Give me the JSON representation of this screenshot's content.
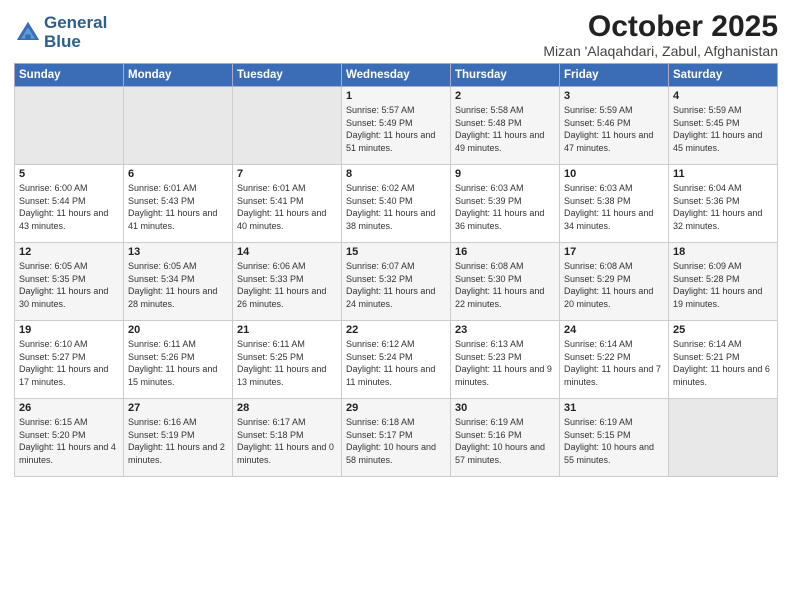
{
  "header": {
    "logo_line1": "General",
    "logo_line2": "Blue",
    "month": "October 2025",
    "location": "Mizan 'Alaqahdari, Zabul, Afghanistan"
  },
  "days_of_week": [
    "Sunday",
    "Monday",
    "Tuesday",
    "Wednesday",
    "Thursday",
    "Friday",
    "Saturday"
  ],
  "weeks": [
    [
      {
        "day": "",
        "sunrise": "",
        "sunset": "",
        "daylight": "",
        "empty": true
      },
      {
        "day": "",
        "sunrise": "",
        "sunset": "",
        "daylight": "",
        "empty": true
      },
      {
        "day": "",
        "sunrise": "",
        "sunset": "",
        "daylight": "",
        "empty": true
      },
      {
        "day": "1",
        "sunrise": "Sunrise: 5:57 AM",
        "sunset": "Sunset: 5:49 PM",
        "daylight": "Daylight: 11 hours and 51 minutes."
      },
      {
        "day": "2",
        "sunrise": "Sunrise: 5:58 AM",
        "sunset": "Sunset: 5:48 PM",
        "daylight": "Daylight: 11 hours and 49 minutes."
      },
      {
        "day": "3",
        "sunrise": "Sunrise: 5:59 AM",
        "sunset": "Sunset: 5:46 PM",
        "daylight": "Daylight: 11 hours and 47 minutes."
      },
      {
        "day": "4",
        "sunrise": "Sunrise: 5:59 AM",
        "sunset": "Sunset: 5:45 PM",
        "daylight": "Daylight: 11 hours and 45 minutes."
      }
    ],
    [
      {
        "day": "5",
        "sunrise": "Sunrise: 6:00 AM",
        "sunset": "Sunset: 5:44 PM",
        "daylight": "Daylight: 11 hours and 43 minutes."
      },
      {
        "day": "6",
        "sunrise": "Sunrise: 6:01 AM",
        "sunset": "Sunset: 5:43 PM",
        "daylight": "Daylight: 11 hours and 41 minutes."
      },
      {
        "day": "7",
        "sunrise": "Sunrise: 6:01 AM",
        "sunset": "Sunset: 5:41 PM",
        "daylight": "Daylight: 11 hours and 40 minutes."
      },
      {
        "day": "8",
        "sunrise": "Sunrise: 6:02 AM",
        "sunset": "Sunset: 5:40 PM",
        "daylight": "Daylight: 11 hours and 38 minutes."
      },
      {
        "day": "9",
        "sunrise": "Sunrise: 6:03 AM",
        "sunset": "Sunset: 5:39 PM",
        "daylight": "Daylight: 11 hours and 36 minutes."
      },
      {
        "day": "10",
        "sunrise": "Sunrise: 6:03 AM",
        "sunset": "Sunset: 5:38 PM",
        "daylight": "Daylight: 11 hours and 34 minutes."
      },
      {
        "day": "11",
        "sunrise": "Sunrise: 6:04 AM",
        "sunset": "Sunset: 5:36 PM",
        "daylight": "Daylight: 11 hours and 32 minutes."
      }
    ],
    [
      {
        "day": "12",
        "sunrise": "Sunrise: 6:05 AM",
        "sunset": "Sunset: 5:35 PM",
        "daylight": "Daylight: 11 hours and 30 minutes."
      },
      {
        "day": "13",
        "sunrise": "Sunrise: 6:05 AM",
        "sunset": "Sunset: 5:34 PM",
        "daylight": "Daylight: 11 hours and 28 minutes."
      },
      {
        "day": "14",
        "sunrise": "Sunrise: 6:06 AM",
        "sunset": "Sunset: 5:33 PM",
        "daylight": "Daylight: 11 hours and 26 minutes."
      },
      {
        "day": "15",
        "sunrise": "Sunrise: 6:07 AM",
        "sunset": "Sunset: 5:32 PM",
        "daylight": "Daylight: 11 hours and 24 minutes."
      },
      {
        "day": "16",
        "sunrise": "Sunrise: 6:08 AM",
        "sunset": "Sunset: 5:30 PM",
        "daylight": "Daylight: 11 hours and 22 minutes."
      },
      {
        "day": "17",
        "sunrise": "Sunrise: 6:08 AM",
        "sunset": "Sunset: 5:29 PM",
        "daylight": "Daylight: 11 hours and 20 minutes."
      },
      {
        "day": "18",
        "sunrise": "Sunrise: 6:09 AM",
        "sunset": "Sunset: 5:28 PM",
        "daylight": "Daylight: 11 hours and 19 minutes."
      }
    ],
    [
      {
        "day": "19",
        "sunrise": "Sunrise: 6:10 AM",
        "sunset": "Sunset: 5:27 PM",
        "daylight": "Daylight: 11 hours and 17 minutes."
      },
      {
        "day": "20",
        "sunrise": "Sunrise: 6:11 AM",
        "sunset": "Sunset: 5:26 PM",
        "daylight": "Daylight: 11 hours and 15 minutes."
      },
      {
        "day": "21",
        "sunrise": "Sunrise: 6:11 AM",
        "sunset": "Sunset: 5:25 PM",
        "daylight": "Daylight: 11 hours and 13 minutes."
      },
      {
        "day": "22",
        "sunrise": "Sunrise: 6:12 AM",
        "sunset": "Sunset: 5:24 PM",
        "daylight": "Daylight: 11 hours and 11 minutes."
      },
      {
        "day": "23",
        "sunrise": "Sunrise: 6:13 AM",
        "sunset": "Sunset: 5:23 PM",
        "daylight": "Daylight: 11 hours and 9 minutes."
      },
      {
        "day": "24",
        "sunrise": "Sunrise: 6:14 AM",
        "sunset": "Sunset: 5:22 PM",
        "daylight": "Daylight: 11 hours and 7 minutes."
      },
      {
        "day": "25",
        "sunrise": "Sunrise: 6:14 AM",
        "sunset": "Sunset: 5:21 PM",
        "daylight": "Daylight: 11 hours and 6 minutes."
      }
    ],
    [
      {
        "day": "26",
        "sunrise": "Sunrise: 6:15 AM",
        "sunset": "Sunset: 5:20 PM",
        "daylight": "Daylight: 11 hours and 4 minutes."
      },
      {
        "day": "27",
        "sunrise": "Sunrise: 6:16 AM",
        "sunset": "Sunset: 5:19 PM",
        "daylight": "Daylight: 11 hours and 2 minutes."
      },
      {
        "day": "28",
        "sunrise": "Sunrise: 6:17 AM",
        "sunset": "Sunset: 5:18 PM",
        "daylight": "Daylight: 11 hours and 0 minutes."
      },
      {
        "day": "29",
        "sunrise": "Sunrise: 6:18 AM",
        "sunset": "Sunset: 5:17 PM",
        "daylight": "Daylight: 10 hours and 58 minutes."
      },
      {
        "day": "30",
        "sunrise": "Sunrise: 6:19 AM",
        "sunset": "Sunset: 5:16 PM",
        "daylight": "Daylight: 10 hours and 57 minutes."
      },
      {
        "day": "31",
        "sunrise": "Sunrise: 6:19 AM",
        "sunset": "Sunset: 5:15 PM",
        "daylight": "Daylight: 10 hours and 55 minutes."
      },
      {
        "day": "",
        "sunrise": "",
        "sunset": "",
        "daylight": "",
        "empty": true
      }
    ]
  ]
}
